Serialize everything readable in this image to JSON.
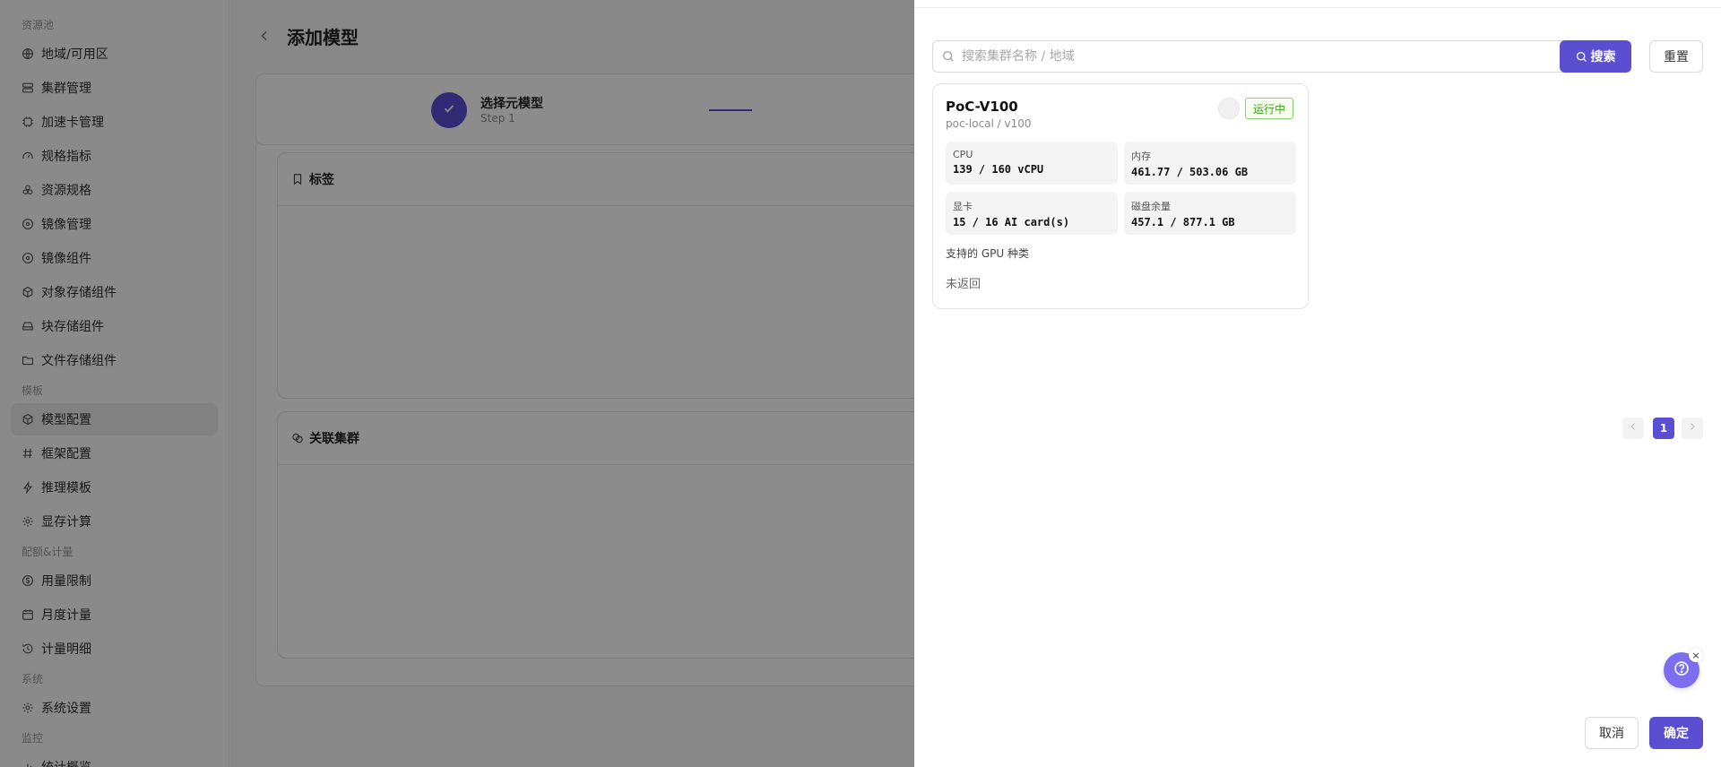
{
  "sidebar": {
    "groups": [
      "资源池",
      "模板",
      "配额&计量",
      "系统",
      "监控"
    ],
    "items": [
      {
        "label": "地域/可用区",
        "icon": "globe-icon"
      },
      {
        "label": "集群管理",
        "icon": "server-icon"
      },
      {
        "label": "加速卡管理",
        "icon": "chip-icon"
      },
      {
        "label": "规格指标",
        "icon": "gauge-icon"
      },
      {
        "label": "资源规格",
        "icon": "layers-icon"
      },
      {
        "label": "镜像管理",
        "icon": "disc-icon"
      },
      {
        "label": "镜像组件",
        "icon": "disc-icon"
      },
      {
        "label": "对象存储组件",
        "icon": "cube-icon"
      },
      {
        "label": "块存储组件",
        "icon": "drive-icon"
      },
      {
        "label": "文件存储组件",
        "icon": "folder-icon"
      },
      {
        "label": "模型配置",
        "icon": "cube-icon",
        "active": true
      },
      {
        "label": "框架配置",
        "icon": "hash-icon"
      },
      {
        "label": "推理模板",
        "icon": "bolt-icon"
      },
      {
        "label": "显存计算",
        "icon": "gear-icon"
      },
      {
        "label": "用量限制",
        "icon": "coin-icon"
      },
      {
        "label": "月度计量",
        "icon": "calendar-icon"
      },
      {
        "label": "计量明细",
        "icon": "history-icon"
      },
      {
        "label": "系统设置",
        "icon": "gear-icon"
      },
      {
        "label": "统计概览",
        "icon": "chart-icon"
      }
    ]
  },
  "main": {
    "title": "添加模型",
    "step1": {
      "title": "选择元模型",
      "sub": "Step 1"
    },
    "sections": {
      "tags": "标签",
      "clusters": "关联集群"
    }
  },
  "drawer": {
    "search": {
      "placeholder": "搜索集群名称 / 地域",
      "button": "搜索",
      "reset": "重置"
    },
    "cluster": {
      "name": "PoC-V100",
      "sub": "poc-local / v100",
      "status": "运行中",
      "metrics": [
        {
          "label": "CPU",
          "value": "139 / 160 vCPU"
        },
        {
          "label": "内存",
          "value": "461.77 / 503.06 GB"
        },
        {
          "label": "显卡",
          "value": "15 / 16 AI card(s)"
        },
        {
          "label": "磁盘余量",
          "value": "457.1 / 877.1 GB"
        }
      ],
      "gpu_label": "支持的 GPU 种类",
      "gpu_value": "未返回"
    },
    "pager": {
      "page": "1"
    },
    "help_close": "×",
    "cancel": "取消",
    "ok": "确定"
  },
  "colors": {
    "accent": "#5b4fd1",
    "status_green": "#3aa018"
  }
}
